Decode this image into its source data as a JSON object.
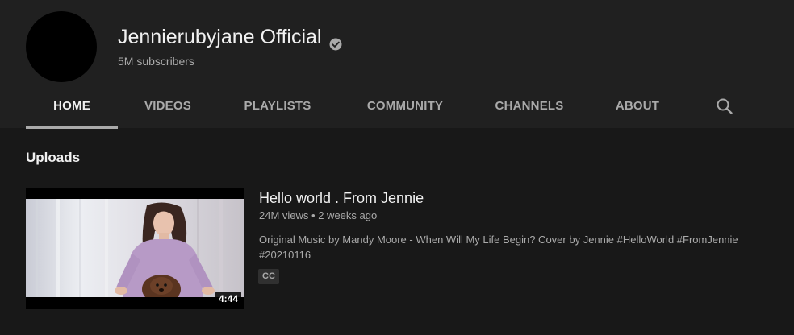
{
  "channel": {
    "name": "Jennierubyjane Official",
    "subscribers": "5M subscribers",
    "verified_icon": "verified-check-icon"
  },
  "tabs": [
    {
      "label": "HOME",
      "active": true
    },
    {
      "label": "VIDEOS",
      "active": false
    },
    {
      "label": "PLAYLISTS",
      "active": false
    },
    {
      "label": "COMMUNITY",
      "active": false
    },
    {
      "label": "CHANNELS",
      "active": false
    },
    {
      "label": "ABOUT",
      "active": false
    }
  ],
  "search_icon": "search-icon",
  "section": {
    "title": "Uploads"
  },
  "video": {
    "title": "Hello world . From Jennie",
    "views": "24M views",
    "age": "2 weeks ago",
    "description": "Original Music by Mandy Moore - When Will My Life Begin? Cover by Jennie #HelloWorld #FromJennie #20210116",
    "duration": "4:44",
    "badge": "CC"
  },
  "colors": {
    "page_bg": "#181818",
    "header_bg": "#202020",
    "text_primary": "#f1f1f1",
    "text_secondary": "#aaaaaa"
  }
}
